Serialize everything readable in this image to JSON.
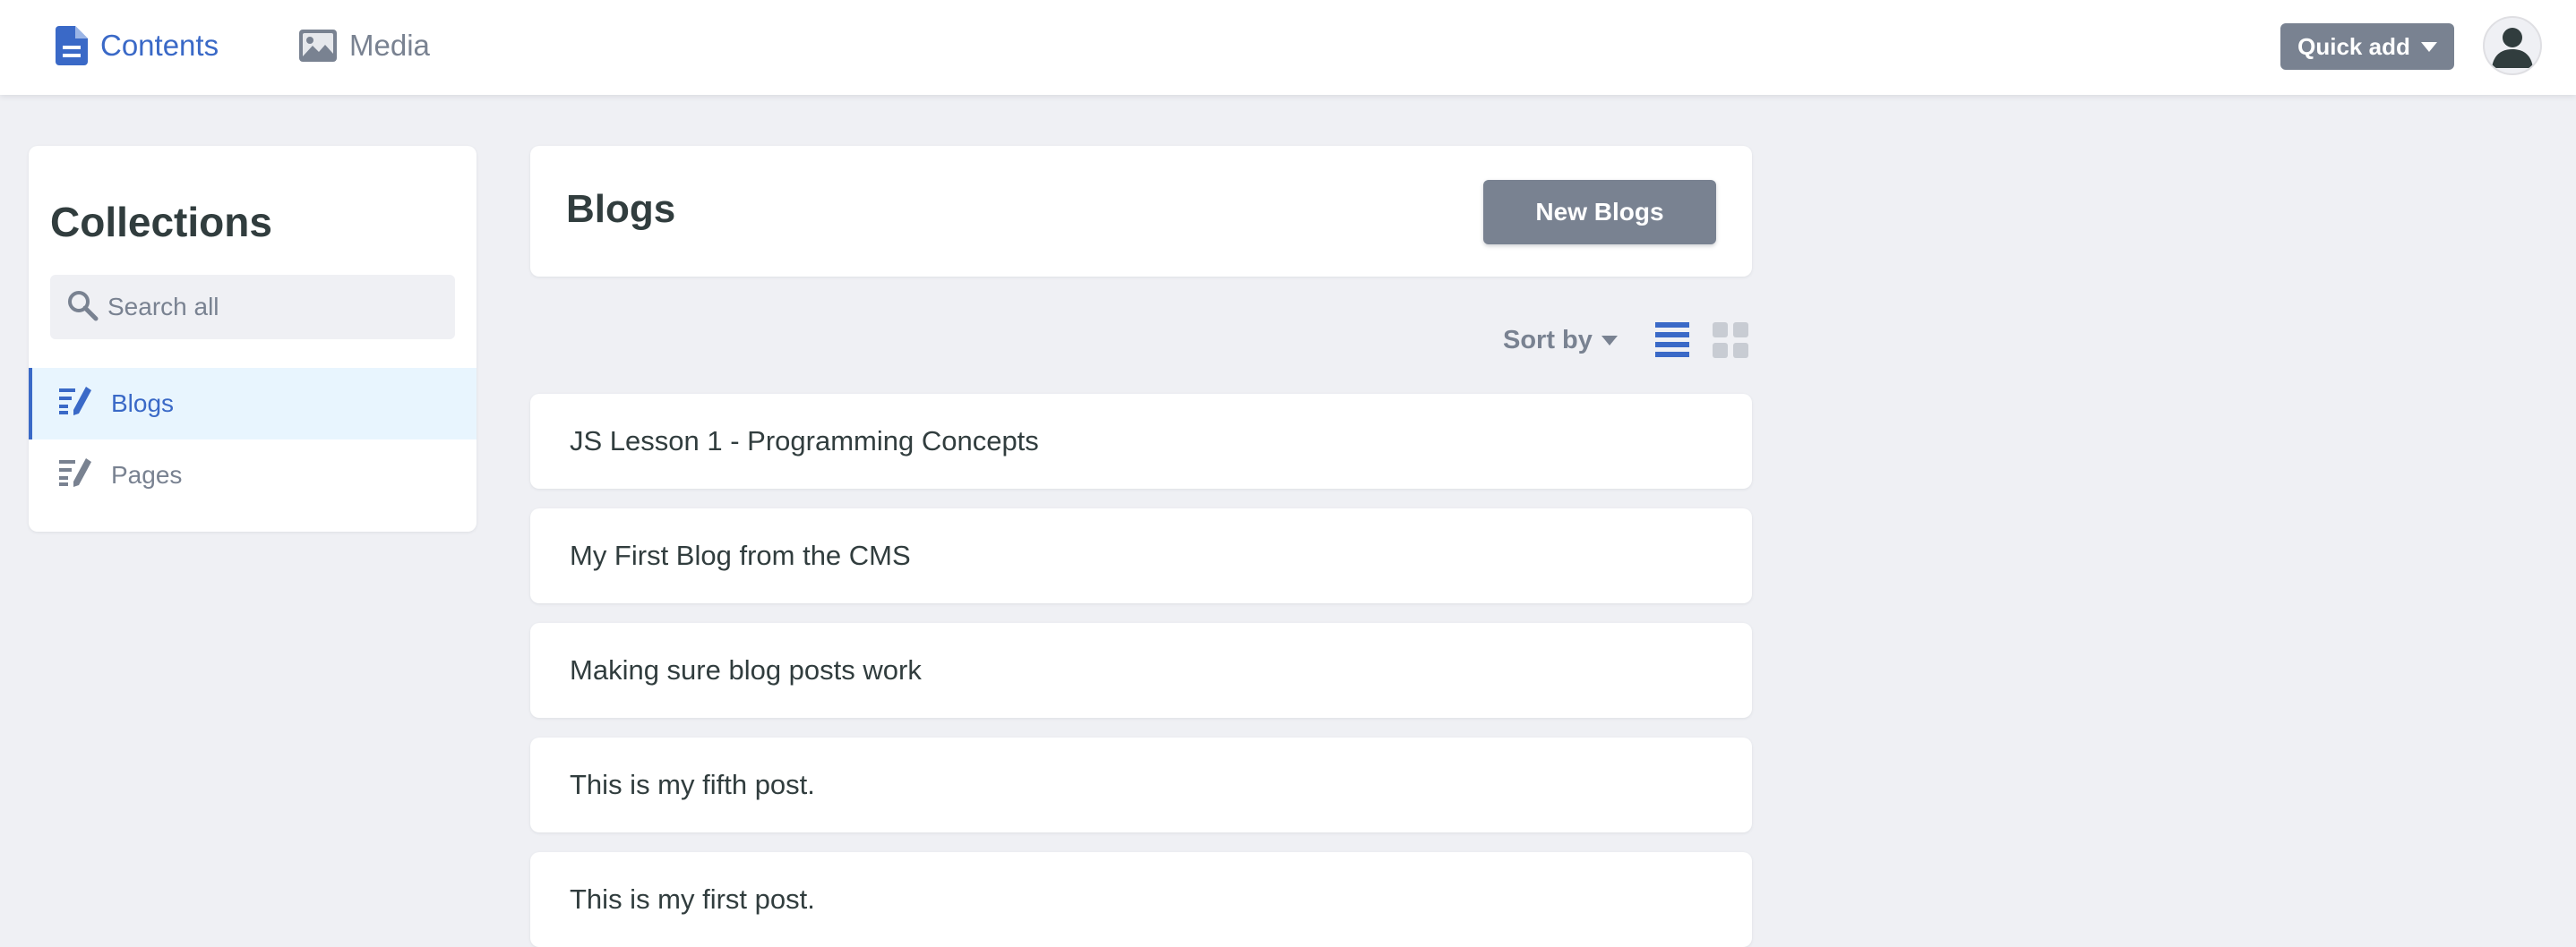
{
  "nav": {
    "contents_label": "Contents",
    "media_label": "Media",
    "quick_add_label": "Quick add"
  },
  "sidebar": {
    "title": "Collections",
    "search_placeholder": "Search all",
    "items": [
      {
        "label": "Blogs",
        "icon": "edit-list-icon",
        "active": true
      },
      {
        "label": "Pages",
        "icon": "edit-list-icon",
        "active": false
      }
    ]
  },
  "main": {
    "title": "Blogs",
    "new_button_label": "New Blogs",
    "sort_label": "Sort by",
    "view_mode": "list",
    "entries": [
      "JS Lesson 1 - Programming Concepts",
      "My First Blog from the CMS",
      "Making sure blog posts work",
      "This is my fifth post.",
      "This is my first post."
    ]
  },
  "colors": {
    "accent": "#3a69c7",
    "muted": "#798291",
    "background": "#eff0f4",
    "active_bg": "#e8f5fe",
    "text": "#313d3e"
  }
}
